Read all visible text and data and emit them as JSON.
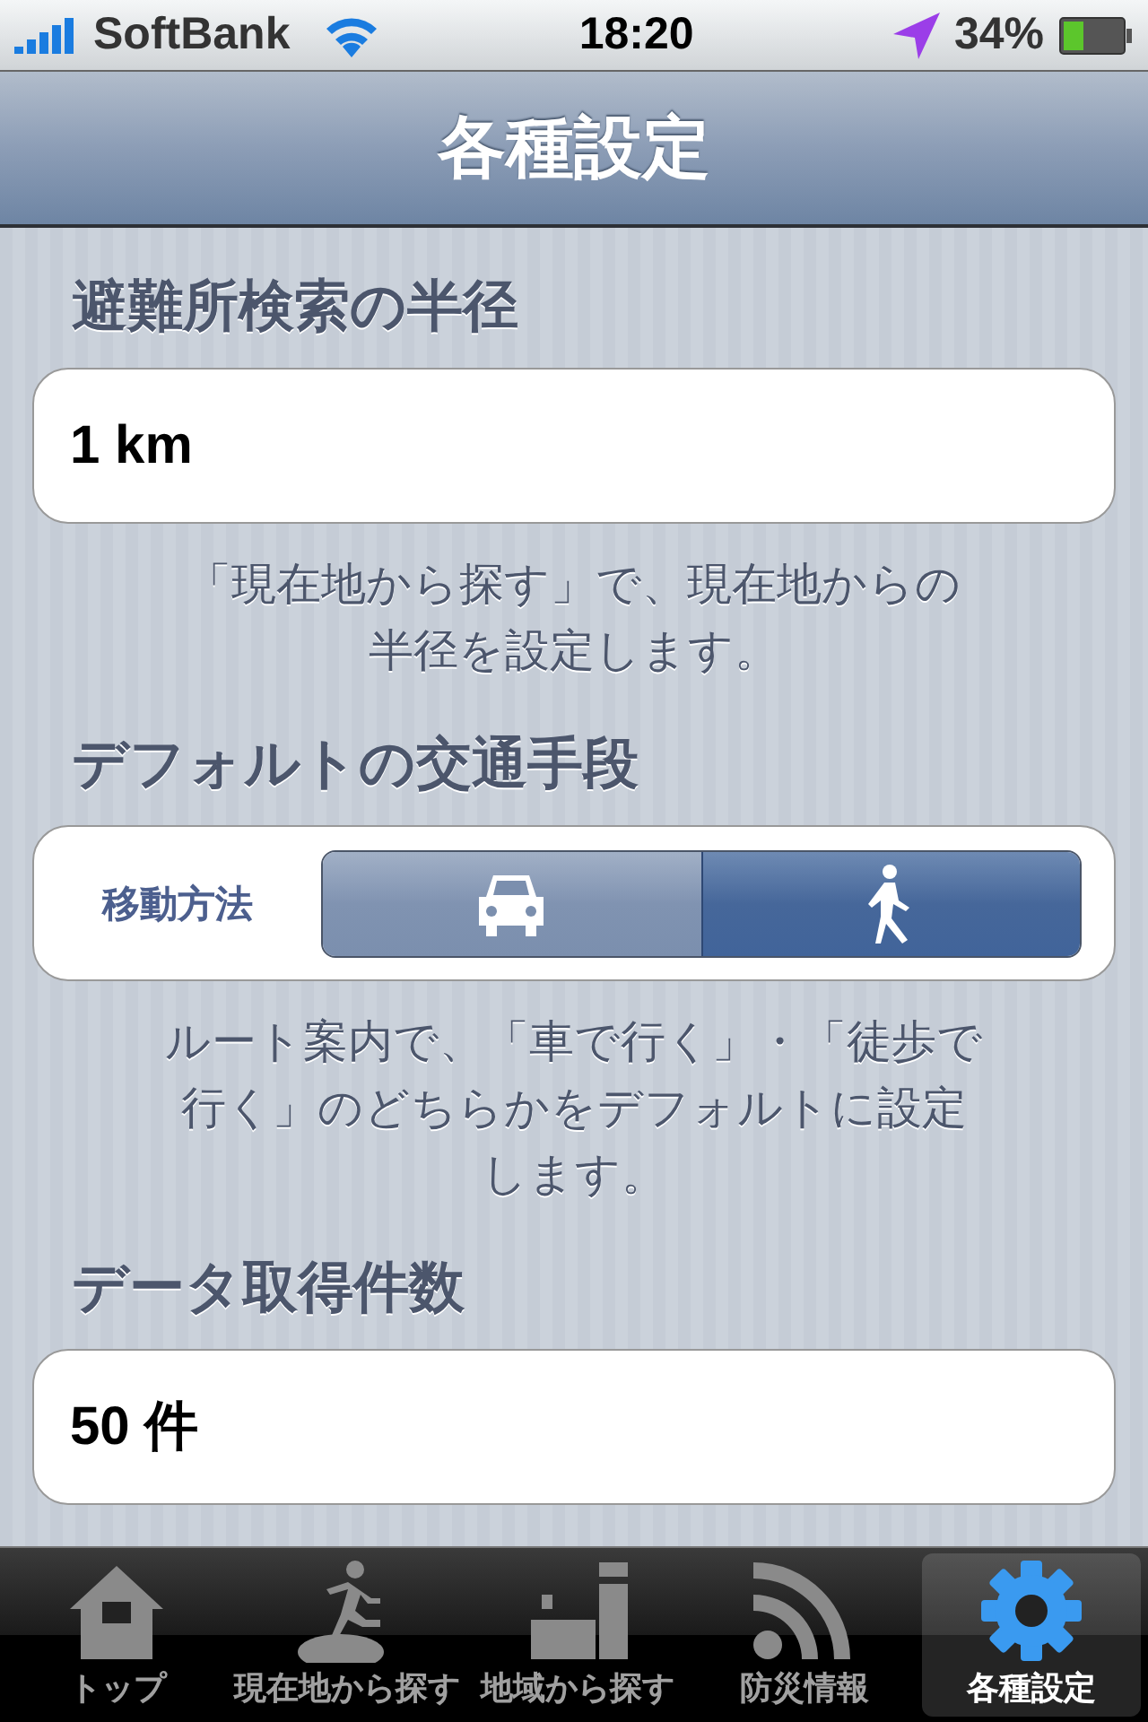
{
  "status_bar": {
    "carrier": "SoftBank",
    "time": "18:20",
    "battery": "34%"
  },
  "nav_bar": {
    "title": "各種設定"
  },
  "sections": [
    {
      "kind": "field",
      "heading": "避難所検索の半径",
      "value": "1 km",
      "note": [
        "「現在地から探す」で、現在地からの",
        "半径を設定します。"
      ]
    },
    {
      "kind": "segmented",
      "heading": "デフォルトの交通手段",
      "label": "移動方法",
      "segments": [
        {
          "kind": "car",
          "selected": false
        },
        {
          "kind": "walk",
          "selected": true
        }
      ],
      "note": [
        "ルート案内で、「車で行く」・「徒歩で",
        "行く」のどちらかをデフォルトに設定",
        "します。"
      ]
    },
    {
      "kind": "field",
      "heading": "データ取得件数",
      "value": "50 件"
    }
  ],
  "tab_bar": [
    {
      "kind": "home",
      "label": "トップ",
      "selected": false
    },
    {
      "kind": "runner",
      "label": "現在地から探す",
      "selected": false
    },
    {
      "kind": "area",
      "label": "地域から探す",
      "selected": false
    },
    {
      "kind": "feed",
      "label": "防災情報",
      "selected": false
    },
    {
      "kind": "gear",
      "label": "各種設定",
      "selected": true
    }
  ]
}
